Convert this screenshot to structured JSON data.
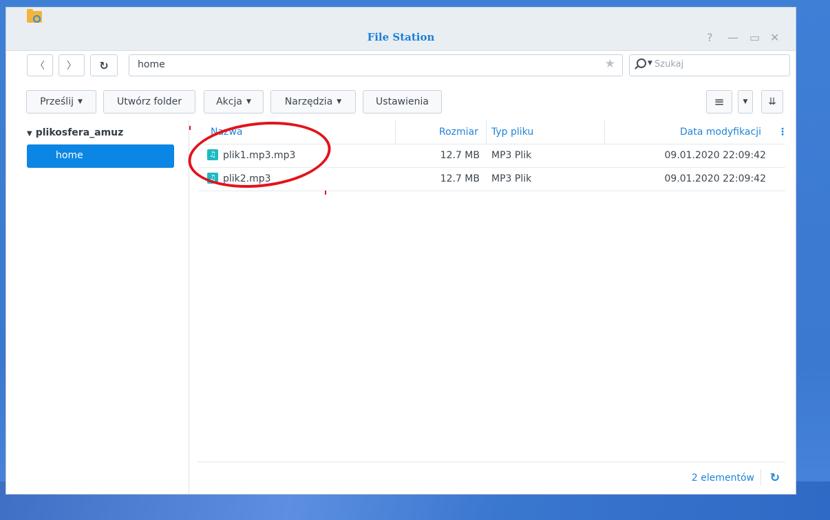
{
  "window": {
    "title": "File Station"
  },
  "nav": {
    "path": "home",
    "search_placeholder": "Szukaj"
  },
  "toolbar": {
    "upload": "Prześlij",
    "create_folder": "Utwórz folder",
    "action": "Akcja",
    "tools": "Narzędzia",
    "settings": "Ustawienia"
  },
  "sidebar": {
    "root": "plikosfera_amuz",
    "items": [
      {
        "label": "home"
      }
    ]
  },
  "columns": {
    "name": "Nazwa",
    "size": "Rozmiar",
    "type": "Typ pliku",
    "modified": "Data modyfikacji"
  },
  "files": [
    {
      "name": "plik1.mp3.mp3",
      "size": "12.7 MB",
      "type": "MP3 Plik",
      "modified": "09.01.2020 22:09:42"
    },
    {
      "name": "plik2.mp3",
      "size": "12.7 MB",
      "type": "MP3 Plik",
      "modified": "09.01.2020 22:09:42"
    }
  ],
  "footer": {
    "count": "2 elementów"
  },
  "colors": {
    "accent": "#0c86e4",
    "annotation": "#e3131b",
    "file_icon": "#1fb9c4"
  }
}
